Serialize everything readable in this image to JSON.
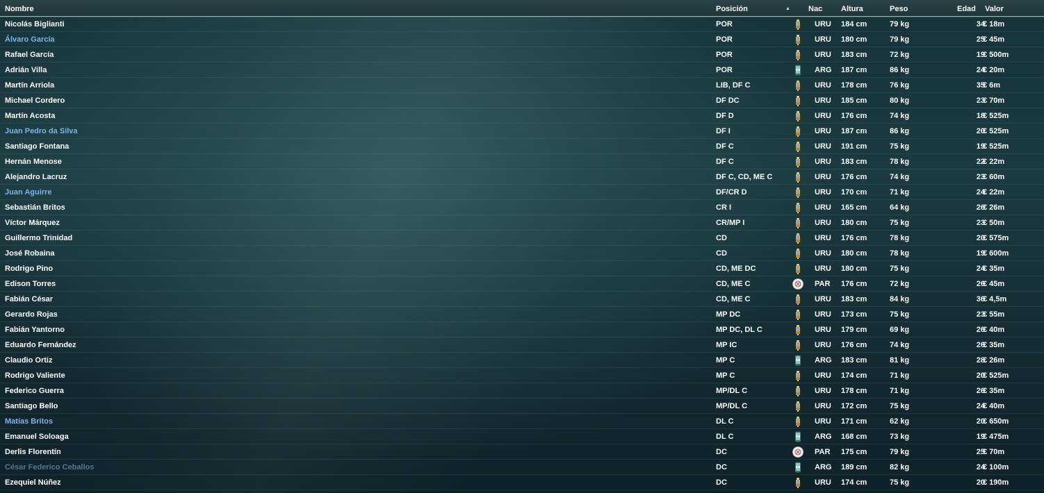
{
  "columns": {
    "nombre": "Nombre",
    "posicion": "Posición",
    "nac": "Nac",
    "altura": "Altura",
    "peso": "Peso",
    "edad": "Edad",
    "valor": "Valor"
  },
  "sort": {
    "column": "Posición",
    "direction": "ascending",
    "icon": "sort-ascending-icon"
  },
  "colors": {
    "default_name": "#ffffff",
    "loan_name": "#7cb2ea",
    "dimmed_name": "#4d7a8a"
  },
  "flags": {
    "URU": "uruguay-badge-icon",
    "ARG": "argentina-badge-icon",
    "PAR": "paraguay-badge-icon"
  },
  "players": [
    {
      "name": "Nicolás Biglianti",
      "style": "default",
      "pos": "POR",
      "nat": "URU",
      "height": "184 cm",
      "weight": "79 kg",
      "age": "34",
      "value": "€ 18m"
    },
    {
      "name": "Álvaro García",
      "style": "loan",
      "pos": "POR",
      "nat": "URU",
      "height": "180 cm",
      "weight": "79 kg",
      "age": "25",
      "value": "€ 45m"
    },
    {
      "name": "Rafael García",
      "style": "default",
      "pos": "POR",
      "nat": "URU",
      "height": "183 cm",
      "weight": "72 kg",
      "age": "19",
      "value": "€ 500m"
    },
    {
      "name": "Adrián Villa",
      "style": "default",
      "pos": "POR",
      "nat": "ARG",
      "height": "187 cm",
      "weight": "86 kg",
      "age": "24",
      "value": "€ 20m"
    },
    {
      "name": "Martín Arriola",
      "style": "default",
      "pos": "LIB, DF C",
      "nat": "URU",
      "height": "178 cm",
      "weight": "76 kg",
      "age": "35",
      "value": "€ 6m"
    },
    {
      "name": "Michael Cordero",
      "style": "default",
      "pos": "DF DC",
      "nat": "URU",
      "height": "185 cm",
      "weight": "80 kg",
      "age": "23",
      "value": "€ 70m"
    },
    {
      "name": "Martín Acosta",
      "style": "default",
      "pos": "DF D",
      "nat": "URU",
      "height": "176 cm",
      "weight": "74 kg",
      "age": "18",
      "value": "€ 525m"
    },
    {
      "name": "Juan Pedro da Silva",
      "style": "loan",
      "pos": "DF I",
      "nat": "URU",
      "height": "187 cm",
      "weight": "86 kg",
      "age": "20",
      "value": "€ 525m"
    },
    {
      "name": "Santiago Fontana",
      "style": "default",
      "pos": "DF C",
      "nat": "URU",
      "height": "191 cm",
      "weight": "75 kg",
      "age": "19",
      "value": "€ 525m"
    },
    {
      "name": "Hernán Menose",
      "style": "default",
      "pos": "DF C",
      "nat": "URU",
      "height": "183 cm",
      "weight": "78 kg",
      "age": "22",
      "value": "€ 22m"
    },
    {
      "name": "Alejandro Lacruz",
      "style": "default",
      "pos": "DF C, CD, ME C",
      "nat": "URU",
      "height": "176 cm",
      "weight": "74 kg",
      "age": "23",
      "value": "€ 60m"
    },
    {
      "name": "Juan Aguirre",
      "style": "loan",
      "pos": "DF/CR D",
      "nat": "URU",
      "height": "170 cm",
      "weight": "71 kg",
      "age": "24",
      "value": "€ 22m"
    },
    {
      "name": "Sebastián Britos",
      "style": "default",
      "pos": "CR I",
      "nat": "URU",
      "height": "165 cm",
      "weight": "64 kg",
      "age": "26",
      "value": "€ 26m"
    },
    {
      "name": "Víctor Márquez",
      "style": "default",
      "pos": "CR/MP I",
      "nat": "URU",
      "height": "180 cm",
      "weight": "75 kg",
      "age": "23",
      "value": "€ 50m"
    },
    {
      "name": "Guillermo Trinidad",
      "style": "default",
      "pos": "CD",
      "nat": "URU",
      "height": "176 cm",
      "weight": "78 kg",
      "age": "20",
      "value": "€ 575m"
    },
    {
      "name": "José Robaina",
      "style": "default",
      "pos": "CD",
      "nat": "URU",
      "height": "180 cm",
      "weight": "78 kg",
      "age": "19",
      "value": "€ 600m"
    },
    {
      "name": "Rodrigo Pino",
      "style": "default",
      "pos": "CD, ME DC",
      "nat": "URU",
      "height": "180 cm",
      "weight": "75 kg",
      "age": "24",
      "value": "€ 35m"
    },
    {
      "name": "Edison Torres",
      "style": "default",
      "pos": "CD, ME C",
      "nat": "PAR",
      "height": "176 cm",
      "weight": "72 kg",
      "age": "26",
      "value": "€ 45m"
    },
    {
      "name": "Fabián César",
      "style": "default",
      "pos": "CD, ME C",
      "nat": "URU",
      "height": "183 cm",
      "weight": "84 kg",
      "age": "36",
      "value": "€ 4,5m"
    },
    {
      "name": "Gerardo Rojas",
      "style": "default",
      "pos": "MP DC",
      "nat": "URU",
      "height": "173 cm",
      "weight": "75 kg",
      "age": "23",
      "value": "€ 55m"
    },
    {
      "name": "Fabián Yantorno",
      "style": "default",
      "pos": "MP DC, DL C",
      "nat": "URU",
      "height": "179 cm",
      "weight": "69 kg",
      "age": "26",
      "value": "€ 40m"
    },
    {
      "name": "Eduardo Fernández",
      "style": "default",
      "pos": "MP IC",
      "nat": "URU",
      "height": "176 cm",
      "weight": "74 kg",
      "age": "26",
      "value": "€ 35m"
    },
    {
      "name": "Claudio Ortiz",
      "style": "default",
      "pos": "MP C",
      "nat": "ARG",
      "height": "183 cm",
      "weight": "81 kg",
      "age": "28",
      "value": "€ 26m"
    },
    {
      "name": "Rodrigo Valiente",
      "style": "default",
      "pos": "MP C",
      "nat": "URU",
      "height": "174 cm",
      "weight": "71 kg",
      "age": "20",
      "value": "€ 525m"
    },
    {
      "name": "Federico Guerra",
      "style": "default",
      "pos": "MP/DL C",
      "nat": "URU",
      "height": "178 cm",
      "weight": "71 kg",
      "age": "26",
      "value": "€ 35m"
    },
    {
      "name": "Santiago Bello",
      "style": "default",
      "pos": "MP/DL C",
      "nat": "URU",
      "height": "172 cm",
      "weight": "75 kg",
      "age": "24",
      "value": "€ 40m"
    },
    {
      "name": "Matías Britos",
      "style": "loan",
      "pos": "DL C",
      "nat": "URU",
      "height": "171 cm",
      "weight": "62 kg",
      "age": "20",
      "value": "€ 650m"
    },
    {
      "name": "Emanuel Soloaga",
      "style": "default",
      "pos": "DL C",
      "nat": "ARG",
      "height": "168 cm",
      "weight": "73 kg",
      "age": "19",
      "value": "€ 475m"
    },
    {
      "name": "Derlis Florentín",
      "style": "default",
      "pos": "DC",
      "nat": "PAR",
      "height": "175 cm",
      "weight": "79 kg",
      "age": "25",
      "value": "€ 70m"
    },
    {
      "name": "César Federico Ceballos",
      "style": "dim",
      "pos": "DC",
      "nat": "ARG",
      "height": "189 cm",
      "weight": "82 kg",
      "age": "24",
      "value": "€ 100m"
    },
    {
      "name": "Ezequiel Núñez",
      "style": "default",
      "pos": "DC",
      "nat": "URU",
      "height": "174 cm",
      "weight": "75 kg",
      "age": "20",
      "value": "€ 190m"
    }
  ]
}
